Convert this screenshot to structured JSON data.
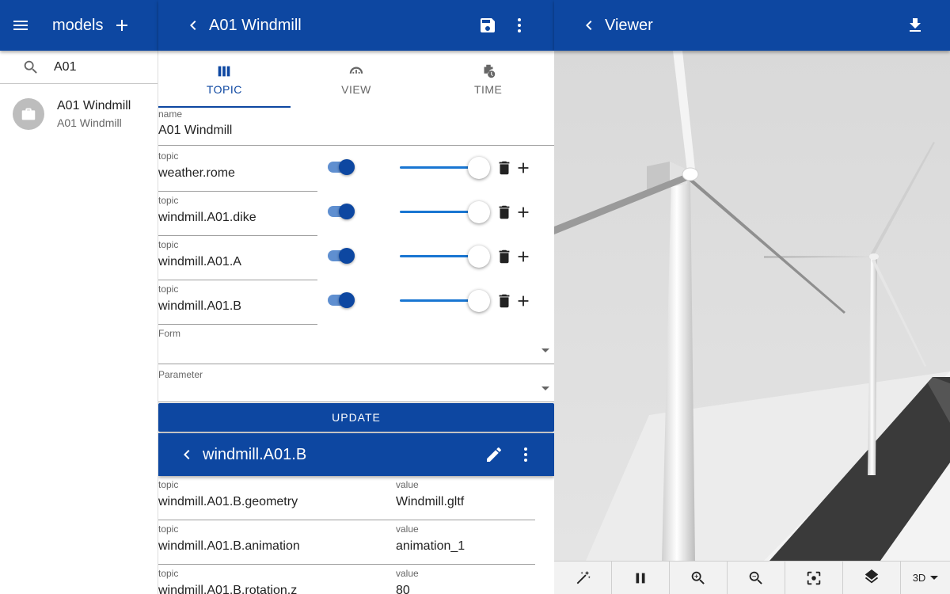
{
  "left": {
    "title": "models",
    "search_value": "A01",
    "items": [
      {
        "primary": "A01 Windmill",
        "secondary": "A01 Windmill"
      }
    ]
  },
  "middle": {
    "title": "A01 Windmill",
    "tabs": [
      {
        "label": "TOPIC",
        "icon": "view-column-icon",
        "active": true
      },
      {
        "label": "VIEW",
        "icon": "view-dashboard-icon",
        "active": false
      },
      {
        "label": "TIME",
        "icon": "history-icon",
        "active": false
      }
    ],
    "name_label": "name",
    "name_value": "A01 Windmill",
    "topic_label": "topic",
    "topics": [
      {
        "value": "weather.rome"
      },
      {
        "value": "windmill.A01.dike"
      },
      {
        "value": "windmill.A01.A"
      },
      {
        "value": "windmill.A01.B"
      }
    ],
    "form_label": "Form",
    "parameter_label": "Parameter",
    "update_label": "UPDATE",
    "detail": {
      "title": "windmill.A01.B",
      "key_label": "topic",
      "value_label": "value",
      "rows": [
        {
          "topic": "windmill.A01.B.geometry",
          "value": "Windmill.gltf"
        },
        {
          "topic": "windmill.A01.B.animation",
          "value": "animation_1"
        },
        {
          "topic": "windmill.A01.B.rotation.z",
          "value": "80"
        }
      ]
    }
  },
  "right": {
    "title": "Viewer",
    "mode": "3D"
  },
  "colors": {
    "primary": "#0d47a1",
    "accent": "#1976d2"
  }
}
